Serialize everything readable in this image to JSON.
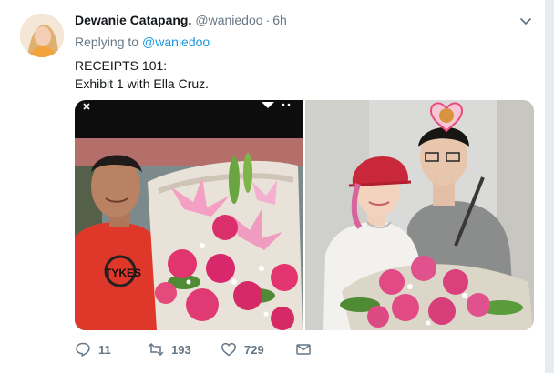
{
  "tweet": {
    "display_name": "Dewanie Catapang.",
    "handle": "@waniedoo",
    "separator": "·",
    "time": "6h",
    "replying_prefix": "Replying to",
    "replying_to": "@waniedoo",
    "text_lines": [
      "RECEIPTS 101:",
      "Exhibit 1 with Ella Cruz."
    ]
  },
  "photos": {
    "left_shirt_text": "TYKES"
  },
  "actions": {
    "reply_count": "11",
    "retweet_count": "193",
    "like_count": "729"
  },
  "icons": {
    "caret": "chevron-down-icon",
    "reply": "reply-icon",
    "retweet": "retweet-icon",
    "like": "heart-icon",
    "dm": "envelope-icon"
  },
  "colors": {
    "link": "#1b95e0",
    "secondary_text": "#657786",
    "primary_text": "#14171a"
  }
}
